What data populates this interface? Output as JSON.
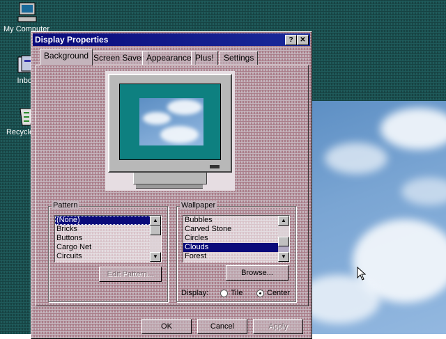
{
  "desktop": {
    "icons": [
      {
        "label": "My Computer",
        "icon": "my-computer-icon"
      },
      {
        "label": "Inbox",
        "icon": "inbox-icon"
      },
      {
        "label": "Recycle Bin",
        "icon": "recycle-bin-icon"
      }
    ],
    "background_color": "#1f5a5a"
  },
  "window": {
    "title": "Display Properties",
    "help_label": "?",
    "close_label": "✕",
    "tabs": [
      {
        "label": "Background",
        "active": true
      },
      {
        "label": "Screen Saver",
        "active": false
      },
      {
        "label": "Appearance",
        "active": false
      },
      {
        "label": "Plus!",
        "active": false
      },
      {
        "label": "Settings",
        "active": false
      }
    ],
    "pattern": {
      "group_label": "Pattern",
      "items": [
        "(None)",
        "Bricks",
        "Buttons",
        "Cargo Net",
        "Circuits"
      ],
      "selected": "(None)",
      "edit_button": "Edit Pattern..."
    },
    "wallpaper": {
      "group_label": "Wallpaper",
      "items": [
        "Bubbles",
        "Carved Stone",
        "Circles",
        "Clouds",
        "Forest"
      ],
      "selected": "Clouds",
      "browse_button": "Browse...",
      "display_label": "Display:",
      "tile_label": "Tile",
      "center_label": "Center",
      "display_mode": "Center"
    },
    "buttons": {
      "ok": "OK",
      "cancel": "Cancel",
      "apply": "Apply"
    }
  }
}
